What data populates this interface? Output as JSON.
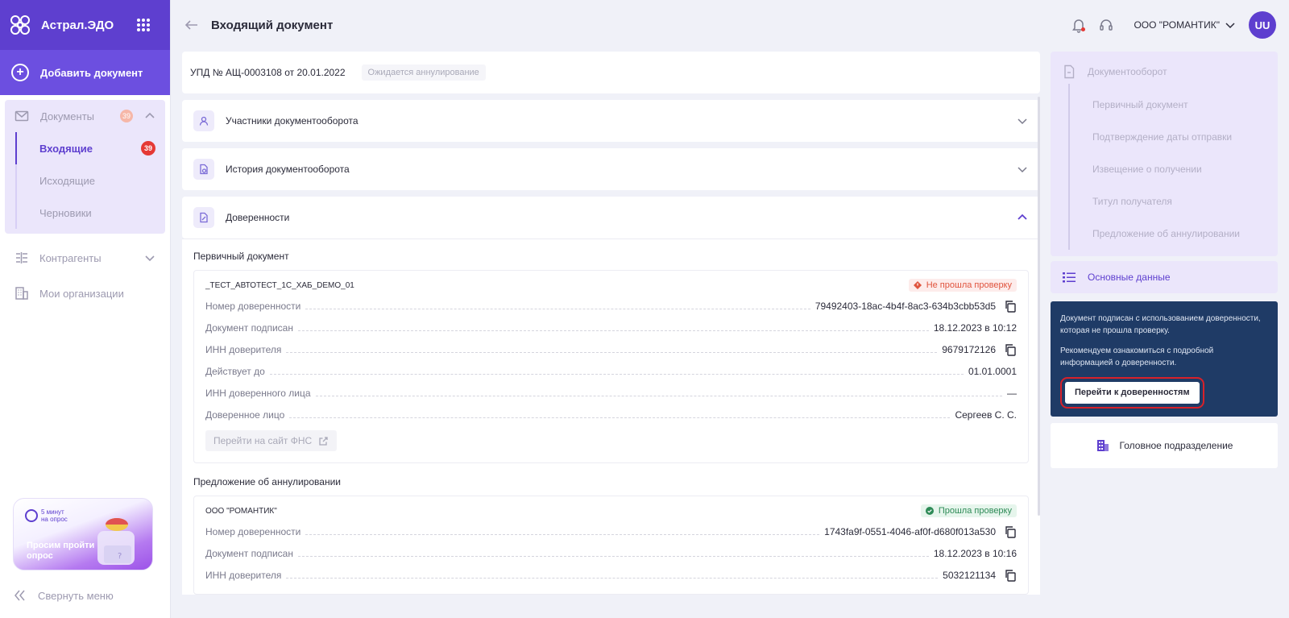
{
  "app": {
    "name": "Астрал.ЭДО"
  },
  "sidebar": {
    "add_document": "Добавить документ",
    "documents": {
      "label": "Документы",
      "badge": "39"
    },
    "sub_items": [
      {
        "label": "Входящие",
        "badge": "39"
      },
      {
        "label": "Исходящие"
      },
      {
        "label": "Черновики"
      }
    ],
    "contractors": "Контрагенты",
    "my_orgs": "Мои организации",
    "survey": {
      "time": "5 минут на опрос",
      "text": "Просим пройти опрос"
    },
    "collapse": "Свернуть меню"
  },
  "header": {
    "title": "Входящий документ",
    "org": "ООО \"РОМАНТИК\"",
    "avatar": "UU"
  },
  "document": {
    "number": "УПД № АЩ-0003108 от 20.01.2022",
    "status": "Ожидается аннулирование"
  },
  "accordions": {
    "participants": "Участники документооборота",
    "history": "История документооборота",
    "powers": "Доверенности"
  },
  "primary": {
    "section_title": "Первичный документ",
    "name": "_ТЕСТ_АВТОТЕСТ_1С_ХАБ_DEMO_01",
    "status": "Не прошла проверку",
    "rows": [
      {
        "k": "Номер доверенности",
        "v": "79492403-18ac-4b4f-8ac3-634b3cbb53d5"
      },
      {
        "k": "Документ подписан",
        "v": "18.12.2023 в 10:12"
      },
      {
        "k": "ИНН доверителя",
        "v": "9679172126"
      },
      {
        "k": "Действует до",
        "v": "01.01.0001"
      },
      {
        "k": "ИНН доверенного лица",
        "v": "—"
      },
      {
        "k": "Доверенное лицо",
        "v": "Сергеев С. С."
      }
    ],
    "fns_button": "Перейти на сайт ФНС"
  },
  "cancellation": {
    "section_title": "Предложение об аннулировании",
    "name": "ООО \"РОМАНТИК\"",
    "status": "Прошла проверку",
    "rows": [
      {
        "k": "Номер доверенности",
        "v": "1743fa9f-0551-4046-af0f-d680f013a530"
      },
      {
        "k": "Документ подписан",
        "v": "18.12.2023 в 10:16"
      },
      {
        "k": "ИНН доверителя",
        "v": "5032121134"
      }
    ]
  },
  "right": {
    "flow_title": "Документооборот",
    "flow_items": [
      "Первичный документ",
      "Подтверждение даты отправки",
      "Извещение о получении",
      "Титул получателя",
      "Предложение об аннулировании"
    ],
    "main_data": "Основные данные",
    "warning": {
      "p1": "Документ подписан с использованием доверенности, которая не прошла проверку.",
      "p2": "Рекомендуем ознакомиться с подробной информацией о доверенности.",
      "button": "Перейти к доверенностям"
    },
    "head_unit": "Головное подразделение"
  },
  "colors": {
    "brand": "#5e3fcf",
    "warning_bg": "#1f3b66",
    "error": "#e53935",
    "success": "#2e8b57"
  }
}
